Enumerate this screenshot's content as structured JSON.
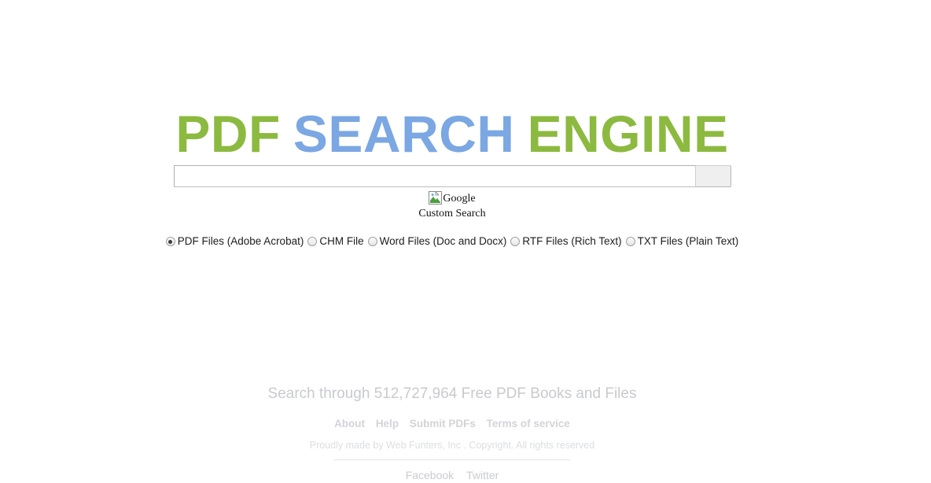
{
  "header": {
    "title_parts": [
      {
        "text": "PDF",
        "color": "#8cba40"
      },
      {
        "text": "SEARCH",
        "color": "#7ba7e3"
      },
      {
        "text": "ENGINE",
        "color": "#8cba40"
      }
    ],
    "title_full": "PDF SEARCH ENGINE"
  },
  "search": {
    "value": "",
    "placeholder": "",
    "button_label": "",
    "button_icon": "search-submit-icon"
  },
  "branding": {
    "broken_image_icon": "broken-image-icon",
    "alt_text_line1": "Google",
    "alt_text_line2": "Custom Search",
    "alt_text_full": "Google Custom Search"
  },
  "file_type_options": [
    {
      "label": "PDF Files (Adobe Acrobat)",
      "value": "pdf",
      "checked": true
    },
    {
      "label": "CHM File",
      "value": "chm",
      "checked": false
    },
    {
      "label": "Word Files (Doc and Docx)",
      "value": "doc",
      "checked": false
    },
    {
      "label": "RTF Files (Rich Text)",
      "value": "rtf",
      "checked": false
    },
    {
      "label": "TXT Files (Plain Text)",
      "value": "txt",
      "checked": false
    }
  ],
  "footer": {
    "tagline": "Search through 512,727,964 Free PDF Books and Files",
    "book_count": "512,727,964",
    "links": [
      {
        "label": "About"
      },
      {
        "label": "Help"
      },
      {
        "label": "Submit PDFs"
      },
      {
        "label": "Terms of service"
      }
    ],
    "copyright": "Proudly made by Web Funters, Inc . Copyright. All rights reserved",
    "social": [
      {
        "label": "Facebook"
      },
      {
        "label": "Twitter"
      }
    ]
  },
  "colors": {
    "brand_green": "#8cba40",
    "brand_blue": "#7ba7e3",
    "footer_gray": "#d2d4d8",
    "tagline_gray": "#c8cace",
    "page_background": "#ffffff"
  }
}
